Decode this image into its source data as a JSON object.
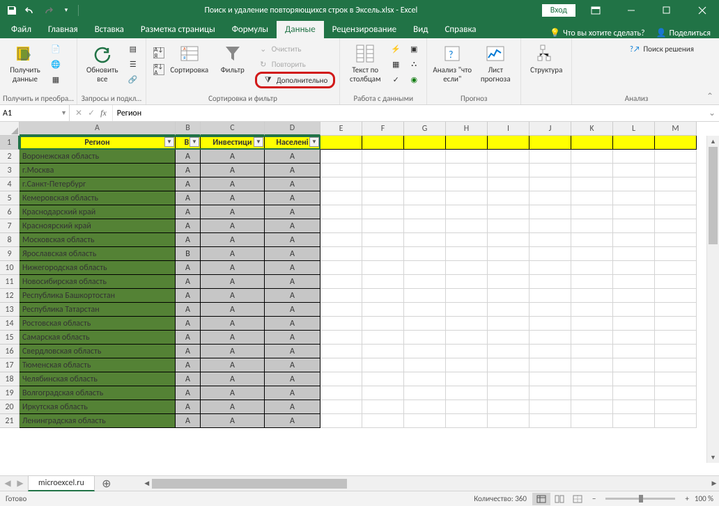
{
  "titlebar": {
    "title": "Поиск и удаление повторяющихся строк в Эксель.xlsx - Excel",
    "login": "Вход"
  },
  "tabs": {
    "file": "Файл",
    "home": "Главная",
    "insert": "Вставка",
    "pagelayout": "Разметка страницы",
    "formulas": "Формулы",
    "data": "Данные",
    "review": "Рецензирование",
    "view": "Вид",
    "help": "Справка",
    "tellme": "Что вы хотите сделать?",
    "share": "Поделиться"
  },
  "ribbon": {
    "get_data": "Получить\nданные",
    "group_get": "Получить и преобра…",
    "refresh": "Обновить\nвсе",
    "group_queries": "Запросы и подкл…",
    "sort": "Сортировка",
    "filter": "Фильтр",
    "clear": "Очистить",
    "reapply": "Повторить",
    "advanced": "Дополнительно",
    "group_sortfilter": "Сортировка и фильтр",
    "texttocols": "Текст по\nстолбцам",
    "group_datatools": "Работа с данными",
    "whatif": "Анализ \"что\nесли\"",
    "forecast": "Лист\nпрогноза",
    "group_forecast": "Прогноз",
    "structure": "Структура",
    "solver": "Поиск решения",
    "group_analysis": "Анализ"
  },
  "namebox": {
    "value": "A1"
  },
  "formula": {
    "value": "Регион"
  },
  "columns": [
    "A",
    "B",
    "C",
    "D",
    "E",
    "F",
    "G",
    "H",
    "I",
    "J",
    "K",
    "L",
    "M"
  ],
  "col_widths": {
    "A": 224,
    "B": 36,
    "C": 92,
    "D": 80,
    "rest": 60
  },
  "headers": {
    "A": "Регион",
    "B": "ВІ",
    "C": "Инвестици",
    "D": "Населені"
  },
  "rows": [
    {
      "n": 2,
      "a": "Воронежская область",
      "b": "A",
      "c": "A",
      "d": "A"
    },
    {
      "n": 3,
      "a": "г.Москва",
      "b": "A",
      "c": "A",
      "d": "A"
    },
    {
      "n": 4,
      "a": "г.Санкт-Петербург",
      "b": "A",
      "c": "A",
      "d": "A"
    },
    {
      "n": 5,
      "a": "Кемеровская область",
      "b": "A",
      "c": "A",
      "d": "A"
    },
    {
      "n": 6,
      "a": "Краснодарский край",
      "b": "A",
      "c": "A",
      "d": "A"
    },
    {
      "n": 7,
      "a": "Красноярский край",
      "b": "A",
      "c": "A",
      "d": "A"
    },
    {
      "n": 8,
      "a": "Московская область",
      "b": "A",
      "c": "A",
      "d": "A"
    },
    {
      "n": 9,
      "a": "Ярославская область",
      "b": "B",
      "c": "A",
      "d": "A"
    },
    {
      "n": 10,
      "a": "Нижегородская область",
      "b": "A",
      "c": "A",
      "d": "A"
    },
    {
      "n": 11,
      "a": "Новосибирская область",
      "b": "A",
      "c": "A",
      "d": "A"
    },
    {
      "n": 12,
      "a": "Республика Башкортостан",
      "b": "A",
      "c": "A",
      "d": "A"
    },
    {
      "n": 13,
      "a": "Республика Татарстан",
      "b": "A",
      "c": "A",
      "d": "A"
    },
    {
      "n": 14,
      "a": "Ростовская область",
      "b": "A",
      "c": "A",
      "d": "A"
    },
    {
      "n": 15,
      "a": "Самарская область",
      "b": "A",
      "c": "A",
      "d": "A"
    },
    {
      "n": 16,
      "a": "Свердловская область",
      "b": "A",
      "c": "A",
      "d": "A"
    },
    {
      "n": 17,
      "a": "Тюменская область",
      "b": "A",
      "c": "A",
      "d": "A"
    },
    {
      "n": 18,
      "a": "Челябинская область",
      "b": "A",
      "c": "A",
      "d": "A"
    },
    {
      "n": 19,
      "a": "Волгоградская область",
      "b": "A",
      "c": "A",
      "d": "A"
    },
    {
      "n": 20,
      "a": "Иркутская область",
      "b": "A",
      "c": "A",
      "d": "A"
    },
    {
      "n": 21,
      "a": "Ленинградская область",
      "b": "A",
      "c": "A",
      "d": "A"
    }
  ],
  "sheet": {
    "name": "microexcel.ru"
  },
  "statusbar": {
    "ready": "Готово",
    "count_label": "Количество:",
    "count": "360",
    "zoom": "100 %"
  }
}
